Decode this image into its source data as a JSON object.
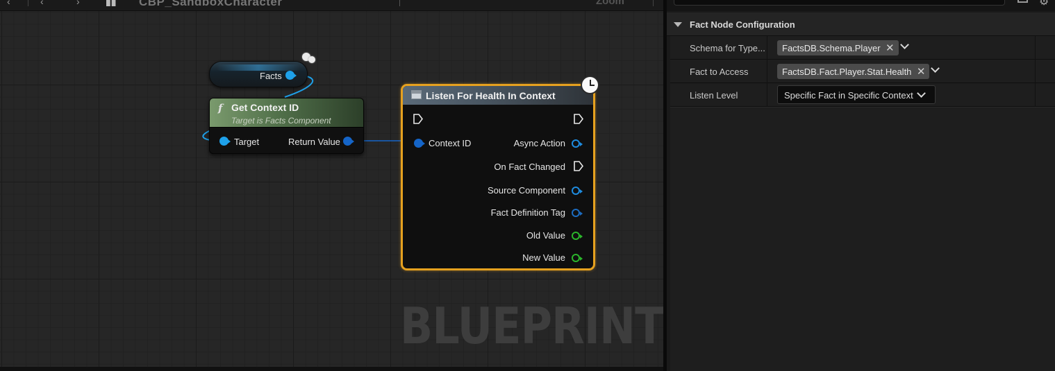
{
  "toolbar": {
    "title": "CBP_SandboxCharacter",
    "zoom": "Zoom"
  },
  "graph": {
    "watermark": "BLUEPRINT",
    "facts_node": {
      "label": "Facts"
    },
    "context_node": {
      "icon": "function-icon",
      "title": "Get Context ID",
      "subtitle": "Target is Facts Component",
      "input_label": "Target",
      "output_label": "Return Value"
    },
    "listen_node": {
      "title": "Listen For Health In Context",
      "input_label": "Context ID",
      "outputs": [
        {
          "label": "Async Action",
          "pin": "object"
        },
        {
          "label": "On Fact Changed",
          "pin": "exec"
        },
        {
          "label": "Source Component",
          "pin": "object"
        },
        {
          "label": "Fact Definition Tag",
          "pin": "struct"
        },
        {
          "label": "Old Value",
          "pin": "float"
        },
        {
          "label": "New Value",
          "pin": "float"
        }
      ]
    },
    "colors": {
      "object_pin": "#1ea1ea",
      "struct_pin": "#1565c8",
      "float_pin": "#2bb62b",
      "selection": "#e6a11f",
      "pure_header": "#51704a",
      "latent_header": "#4a5763"
    }
  },
  "details": {
    "category": "Fact Node Configuration",
    "rows": [
      {
        "name": "Schema for Type...",
        "value": "FactsDB.Schema.Player"
      },
      {
        "name": "Fact to Access",
        "value": "FactsDB.Fact.Player.Stat.Health"
      },
      {
        "name": "Listen Level",
        "value": "Specific Fact in Specific Context"
      }
    ]
  }
}
